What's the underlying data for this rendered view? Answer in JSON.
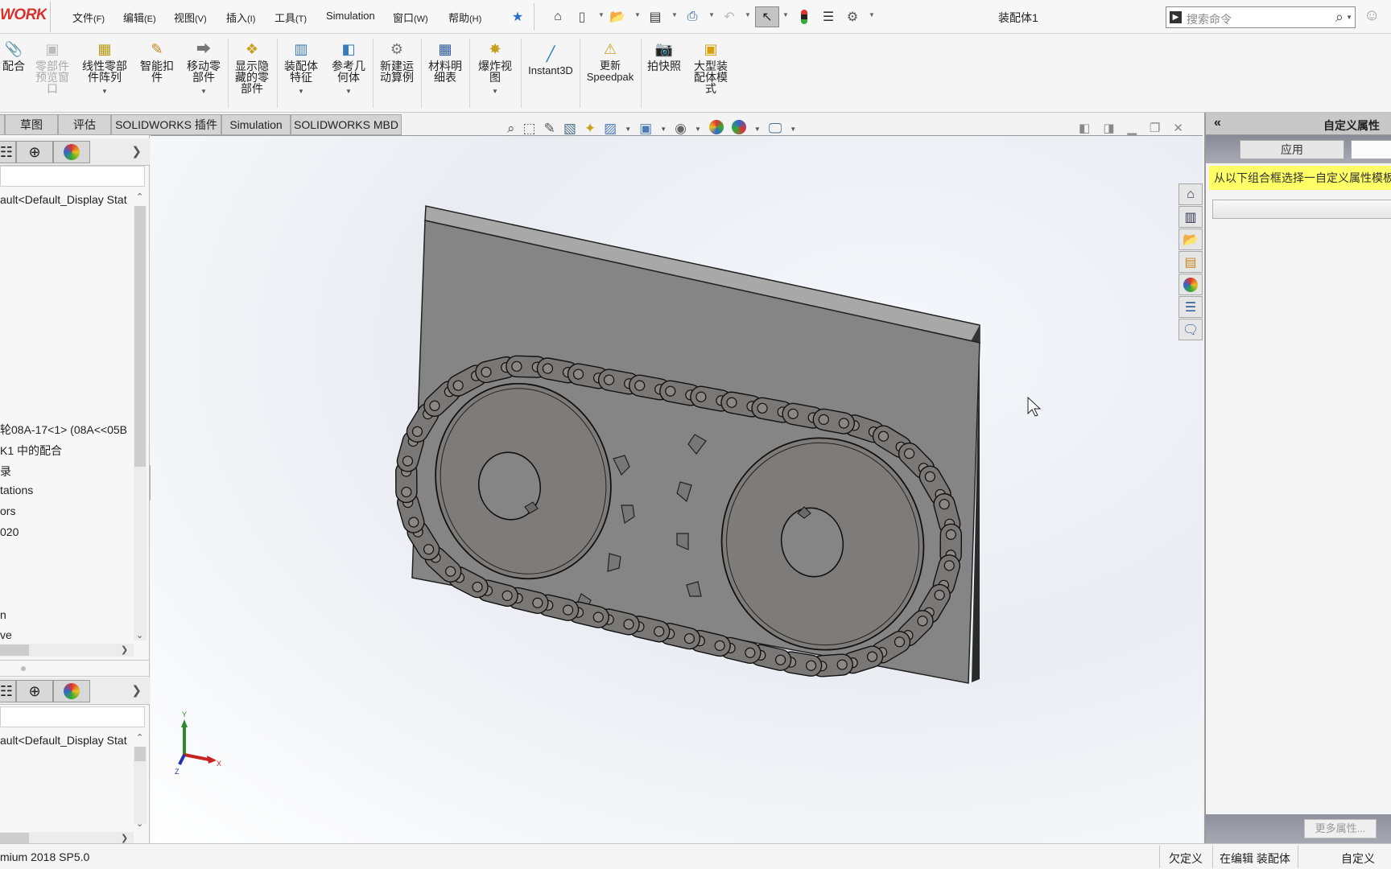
{
  "app": {
    "logo": "WORKS",
    "document_title": "装配体1"
  },
  "menu": [
    {
      "label": "文件",
      "accel": "(F)"
    },
    {
      "label": "编辑",
      "accel": "(E)"
    },
    {
      "label": "视图",
      "accel": "(V)"
    },
    {
      "label": "插入",
      "accel": "(I)"
    },
    {
      "label": "工具",
      "accel": "(T)"
    },
    {
      "label": "Simulation",
      "accel": ""
    },
    {
      "label": "窗口",
      "accel": "(W)"
    },
    {
      "label": "帮助",
      "accel": "(H)"
    }
  ],
  "quick_access": {
    "icons": [
      "pin-icon",
      "home-icon",
      "new-document-icon",
      "open-icon",
      "save-icon",
      "print-icon",
      "undo-icon",
      "select-icon",
      "rebuild-icon",
      "file-properties-icon",
      "options-icon"
    ]
  },
  "search": {
    "placeholder": "搜索命令"
  },
  "ribbon": [
    {
      "label": "配合",
      "icon": "mate-icon",
      "dropdown": false,
      "disabled": false
    },
    {
      "label": "零部件预览窗口",
      "icon": "component-preview-icon",
      "dropdown": false,
      "disabled": true
    },
    {
      "label": "线性零部件阵列",
      "icon": "linear-pattern-icon",
      "dropdown": true,
      "disabled": false
    },
    {
      "label": "智能扣件",
      "icon": "smart-fasteners-icon",
      "dropdown": false,
      "disabled": false
    },
    {
      "label": "移动零部件",
      "icon": "move-component-icon",
      "dropdown": true,
      "disabled": false
    },
    {
      "label": "显示隐藏的零部件",
      "icon": "show-hidden-icon",
      "dropdown": false,
      "disabled": false
    },
    {
      "label": "装配体特征",
      "icon": "assembly-features-icon",
      "dropdown": true,
      "disabled": false
    },
    {
      "label": "参考几何体",
      "icon": "reference-geometry-icon",
      "dropdown": true,
      "disabled": false
    },
    {
      "label": "新建运动算例",
      "icon": "motion-study-icon",
      "dropdown": false,
      "disabled": false
    },
    {
      "label": "材料明细表",
      "icon": "bom-icon",
      "dropdown": false,
      "disabled": false
    },
    {
      "label": "爆炸视图",
      "icon": "exploded-view-icon",
      "dropdown": true,
      "disabled": false
    },
    {
      "label": "Instant3D",
      "icon": "instant3d-icon",
      "dropdown": false,
      "disabled": false
    },
    {
      "label": "更新 Speedpak",
      "icon": "speedpak-icon",
      "dropdown": false,
      "disabled": false
    },
    {
      "label": "拍快照",
      "icon": "snapshot-icon",
      "dropdown": false,
      "disabled": false
    },
    {
      "label": "大型装配体模式",
      "icon": "large-assembly-icon",
      "dropdown": false,
      "disabled": false
    }
  ],
  "tabs": [
    "草图",
    "评估",
    "SOLIDWORKS 插件",
    "Simulation",
    "SOLIDWORKS MBD"
  ],
  "feature_manager": {
    "config_line": "ault<Default_Display Stat",
    "tree_items": [
      "轮08A-17<1> (08A<<05B",
      "K1 中的配合",
      "录",
      "tations",
      "ors",
      "020",
      "n",
      "ve"
    ],
    "lower_config_line": "ault<Default_Display Stat"
  },
  "viewport": {
    "heads_up_icons": [
      "zoom-to-fit-icon",
      "zoom-area-icon",
      "previous-view-icon",
      "section-view-icon",
      "dynamic-annotation-icon",
      "view-orientation-icon",
      "display-style-icon",
      "hide-show-icon",
      "edit-appearance-icon",
      "apply-scene-icon",
      "view-settings-icon"
    ],
    "triad": {
      "x": "X",
      "y": "Y",
      "z": "Z"
    }
  },
  "task_pane": {
    "title": "自定义属性",
    "apply_label": "应用",
    "message": "从以下组合框选择一自定义属性模板",
    "more_label": "更多属性...",
    "side_tabs": [
      "home-icon",
      "design-library-icon",
      "file-explorer-icon",
      "view-palette-icon",
      "appearances-icon",
      "custom-properties-icon",
      "forum-icon"
    ]
  },
  "status": {
    "version": "mium 2018 SP5.0",
    "definition": "欠定义",
    "editing": "在编辑 装配体",
    "custom": "自定义"
  }
}
